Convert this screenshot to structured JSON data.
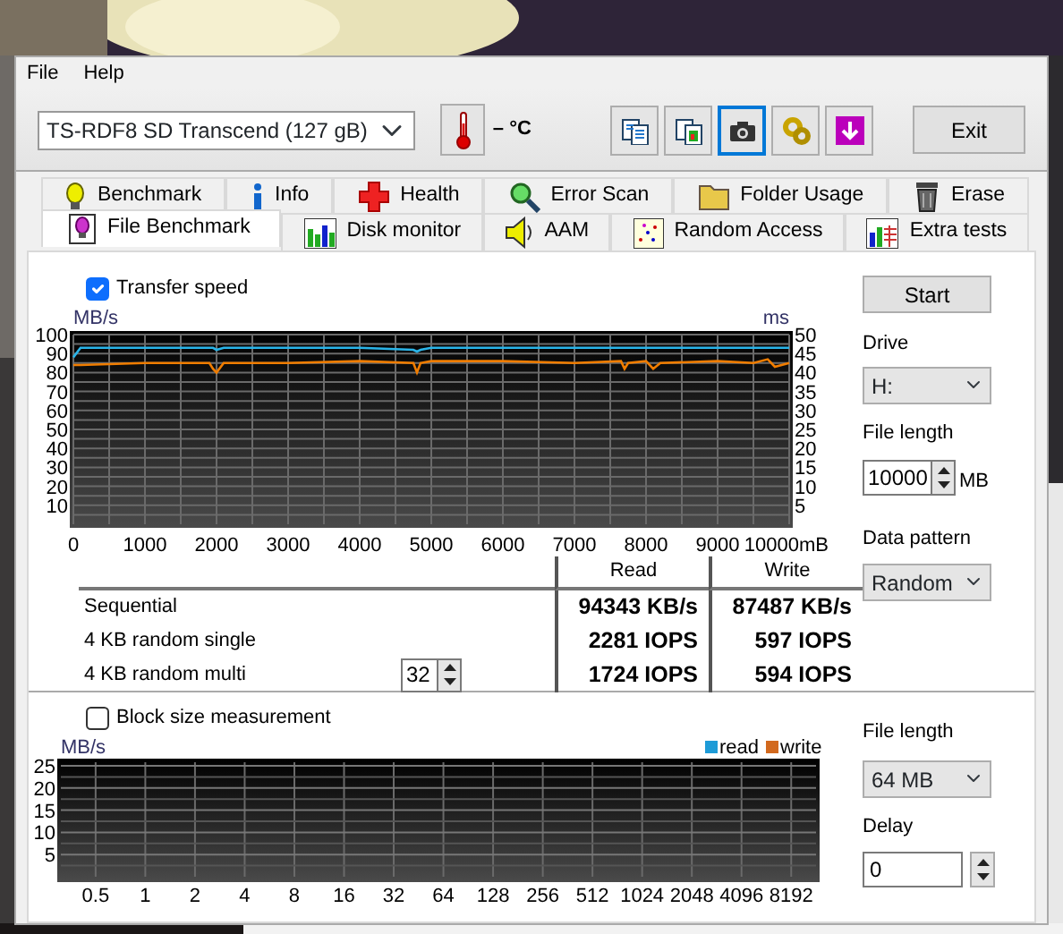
{
  "menu": [
    {
      "label": "File"
    },
    {
      "label": "Help"
    }
  ],
  "toolbar": {
    "drive": "TS-RDF8 SD  Transcend (127 gB)",
    "temperature": "– °C",
    "tools": [
      {
        "selected": false
      },
      {
        "selected": false
      },
      {
        "selected": true
      },
      {
        "selected": false
      },
      {
        "selected": false
      }
    ],
    "exit": "Exit"
  },
  "tabs_row1": [
    {
      "label": "Benchmark",
      "selected": false
    },
    {
      "label": "Info",
      "selected": false
    },
    {
      "label": "Health",
      "selected": false
    },
    {
      "label": "Error Scan",
      "selected": false
    },
    {
      "label": "Folder Usage",
      "selected": false
    },
    {
      "label": "Erase",
      "selected": false
    }
  ],
  "tabs_row2": [
    {
      "label": "File Benchmark",
      "selected": true
    },
    {
      "label": "Disk monitor",
      "selected": false
    },
    {
      "label": "AAM",
      "selected": false
    },
    {
      "label": "Random Access",
      "selected": false
    },
    {
      "label": "Extra tests",
      "selected": false
    }
  ],
  "transfer_speed": {
    "label": "Transfer speed",
    "checked": true,
    "chart_data": {
      "type": "line",
      "ylabel": "MB/s",
      "x": [
        0,
        100,
        1000,
        1900,
        1950,
        2000,
        2100,
        3000,
        4000,
        4750,
        4800,
        4850,
        5000,
        6000,
        7000,
        7650,
        7700,
        7750,
        8000,
        8100,
        8200,
        9000,
        9500,
        9700,
        9800,
        10000
      ],
      "series": [
        {
          "color": "#2ab4e8",
          "values": [
            88,
            93,
            93,
            93,
            93,
            92,
            93,
            93,
            93,
            92,
            91,
            92,
            93,
            93,
            93,
            93,
            93,
            93,
            93,
            93,
            93,
            93,
            93,
            93,
            93,
            93
          ]
        },
        {
          "color": "#f07d00",
          "values": [
            84,
            84,
            85,
            85,
            82,
            80,
            85,
            85,
            86,
            85,
            80,
            85,
            86,
            86,
            85,
            86,
            82,
            85,
            86,
            82,
            85,
            86,
            85,
            87,
            83,
            85
          ]
        }
      ],
      "xlim": [
        0,
        10000
      ],
      "ylim": [
        0,
        100
      ],
      "grid": true,
      "xticks": [
        0,
        1000,
        2000,
        3000,
        4000,
        5000,
        6000,
        7000,
        8000,
        9000,
        {
          "value": 10000,
          "label": "10000mB"
        }
      ],
      "yticks": [
        10,
        20,
        30,
        40,
        50,
        60,
        70,
        80,
        90,
        100
      ]
    },
    "right_axis": {
      "label": "ms",
      "ticks": [
        "50",
        "45",
        "40",
        "35",
        "30",
        "25",
        "20",
        "15",
        "10",
        "5"
      ]
    }
  },
  "results": {
    "columns": [
      "Read",
      "Write"
    ],
    "rows": [
      {
        "label": "Sequential",
        "read": "94343 KB/s",
        "write": "87487 KB/s"
      },
      {
        "label": "4 KB random single",
        "read": "2281 IOPS",
        "write": "597 IOPS"
      },
      {
        "label": "4 KB random multi",
        "queue_depth": "32",
        "read": "1724 IOPS",
        "write": "594 IOPS"
      }
    ]
  },
  "block_size": {
    "label": "Block size measurement",
    "checked": false,
    "chart_data": {
      "type": "bar",
      "ylabel": "MB/s",
      "categories": [
        "0.5",
        "1",
        "2",
        "4",
        "8",
        "16",
        "32",
        "64",
        "128",
        "256",
        "512",
        "1024",
        "2048",
        "4096",
        "8192"
      ],
      "ylim": [
        0,
        25
      ],
      "yticks": [
        5,
        10,
        15,
        20,
        25
      ],
      "grid": true
    },
    "legend": [
      {
        "label": "read",
        "color": "#1e9bd7"
      },
      {
        "label": "write",
        "color": "#d2691e"
      }
    ]
  },
  "settings": {
    "start": "Start",
    "drive_label": "Drive",
    "drive": "H:",
    "file_length_label": "File length",
    "file_length": "10000",
    "file_length_unit": "MB",
    "pattern_label": "Data pattern",
    "pattern": "Random"
  },
  "block_settings": {
    "file_length_label": "File length",
    "file_length": "64 MB",
    "delay_label": "Delay",
    "delay": "0"
  }
}
